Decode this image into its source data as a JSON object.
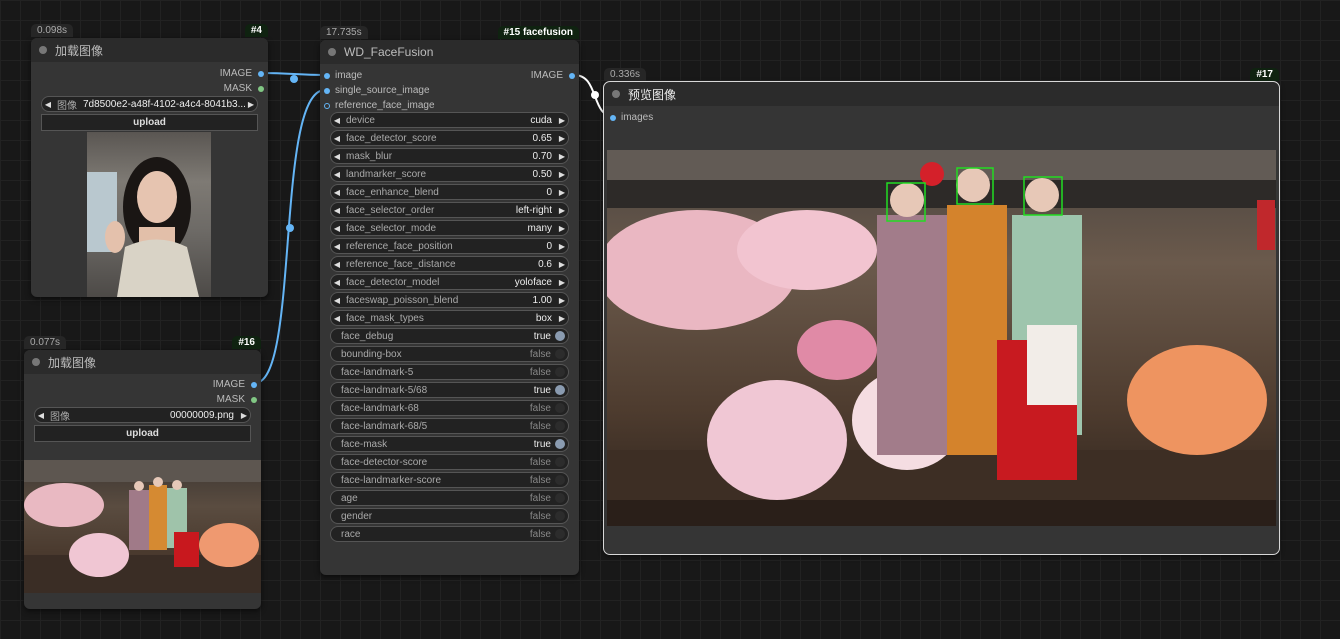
{
  "node4": {
    "timing": "0.098s",
    "badge": "#4",
    "title": "加载图像",
    "out_image": "IMAGE",
    "out_mask": "MASK",
    "image_label": "图像",
    "image_value": "7d8500e2-a48f-4102-a4c4-8041b3...",
    "upload_label": "upload"
  },
  "node16": {
    "timing": "0.077s",
    "badge": "#16",
    "title": "加载图像",
    "out_image": "IMAGE",
    "out_mask": "MASK",
    "image_label": "图像",
    "image_value": "00000009.png",
    "upload_label": "upload"
  },
  "node15": {
    "timing": "17.735s",
    "badge": "#15 facefusion",
    "title": "WD_FaceFusion",
    "inputs": [
      "image",
      "single_source_image",
      "reference_face_image"
    ],
    "out_image": "IMAGE",
    "combos": [
      {
        "label": "device",
        "value": "cuda"
      },
      {
        "label": "face_detector_score",
        "value": "0.65"
      },
      {
        "label": "mask_blur",
        "value": "0.70"
      },
      {
        "label": "landmarker_score",
        "value": "0.50"
      },
      {
        "label": "face_enhance_blend",
        "value": "0"
      },
      {
        "label": "face_selector_order",
        "value": "left-right"
      },
      {
        "label": "face_selector_mode",
        "value": "many"
      },
      {
        "label": "reference_face_position",
        "value": "0"
      },
      {
        "label": "reference_face_distance",
        "value": "0.6"
      },
      {
        "label": "face_detector_model",
        "value": "yoloface"
      },
      {
        "label": "faceswap_poisson_blend",
        "value": "1.00"
      },
      {
        "label": "face_mask_types",
        "value": "box"
      }
    ],
    "toggles": [
      {
        "label": "face_debug",
        "value": "true",
        "on": true
      },
      {
        "label": "bounding-box",
        "value": "false",
        "on": false
      },
      {
        "label": "face-landmark-5",
        "value": "false",
        "on": false
      },
      {
        "label": "face-landmark-5/68",
        "value": "true",
        "on": true
      },
      {
        "label": "face-landmark-68",
        "value": "false",
        "on": false
      },
      {
        "label": "face-landmark-68/5",
        "value": "false",
        "on": false
      },
      {
        "label": "face-mask",
        "value": "true",
        "on": true
      },
      {
        "label": "face-detector-score",
        "value": "false",
        "on": false
      },
      {
        "label": "face-landmarker-score",
        "value": "false",
        "on": false
      },
      {
        "label": "age",
        "value": "false",
        "on": false
      },
      {
        "label": "gender",
        "value": "false",
        "on": false
      },
      {
        "label": "race",
        "value": "false",
        "on": false
      }
    ]
  },
  "node17": {
    "timing": "0.336s",
    "badge": "#17",
    "title": "预览图像",
    "in_images": "images"
  },
  "colors": {
    "wire": "#64b5f6",
    "image_slot": "#64b5f6",
    "mask_slot": "#81c784",
    "face_box": "#22dd22"
  }
}
